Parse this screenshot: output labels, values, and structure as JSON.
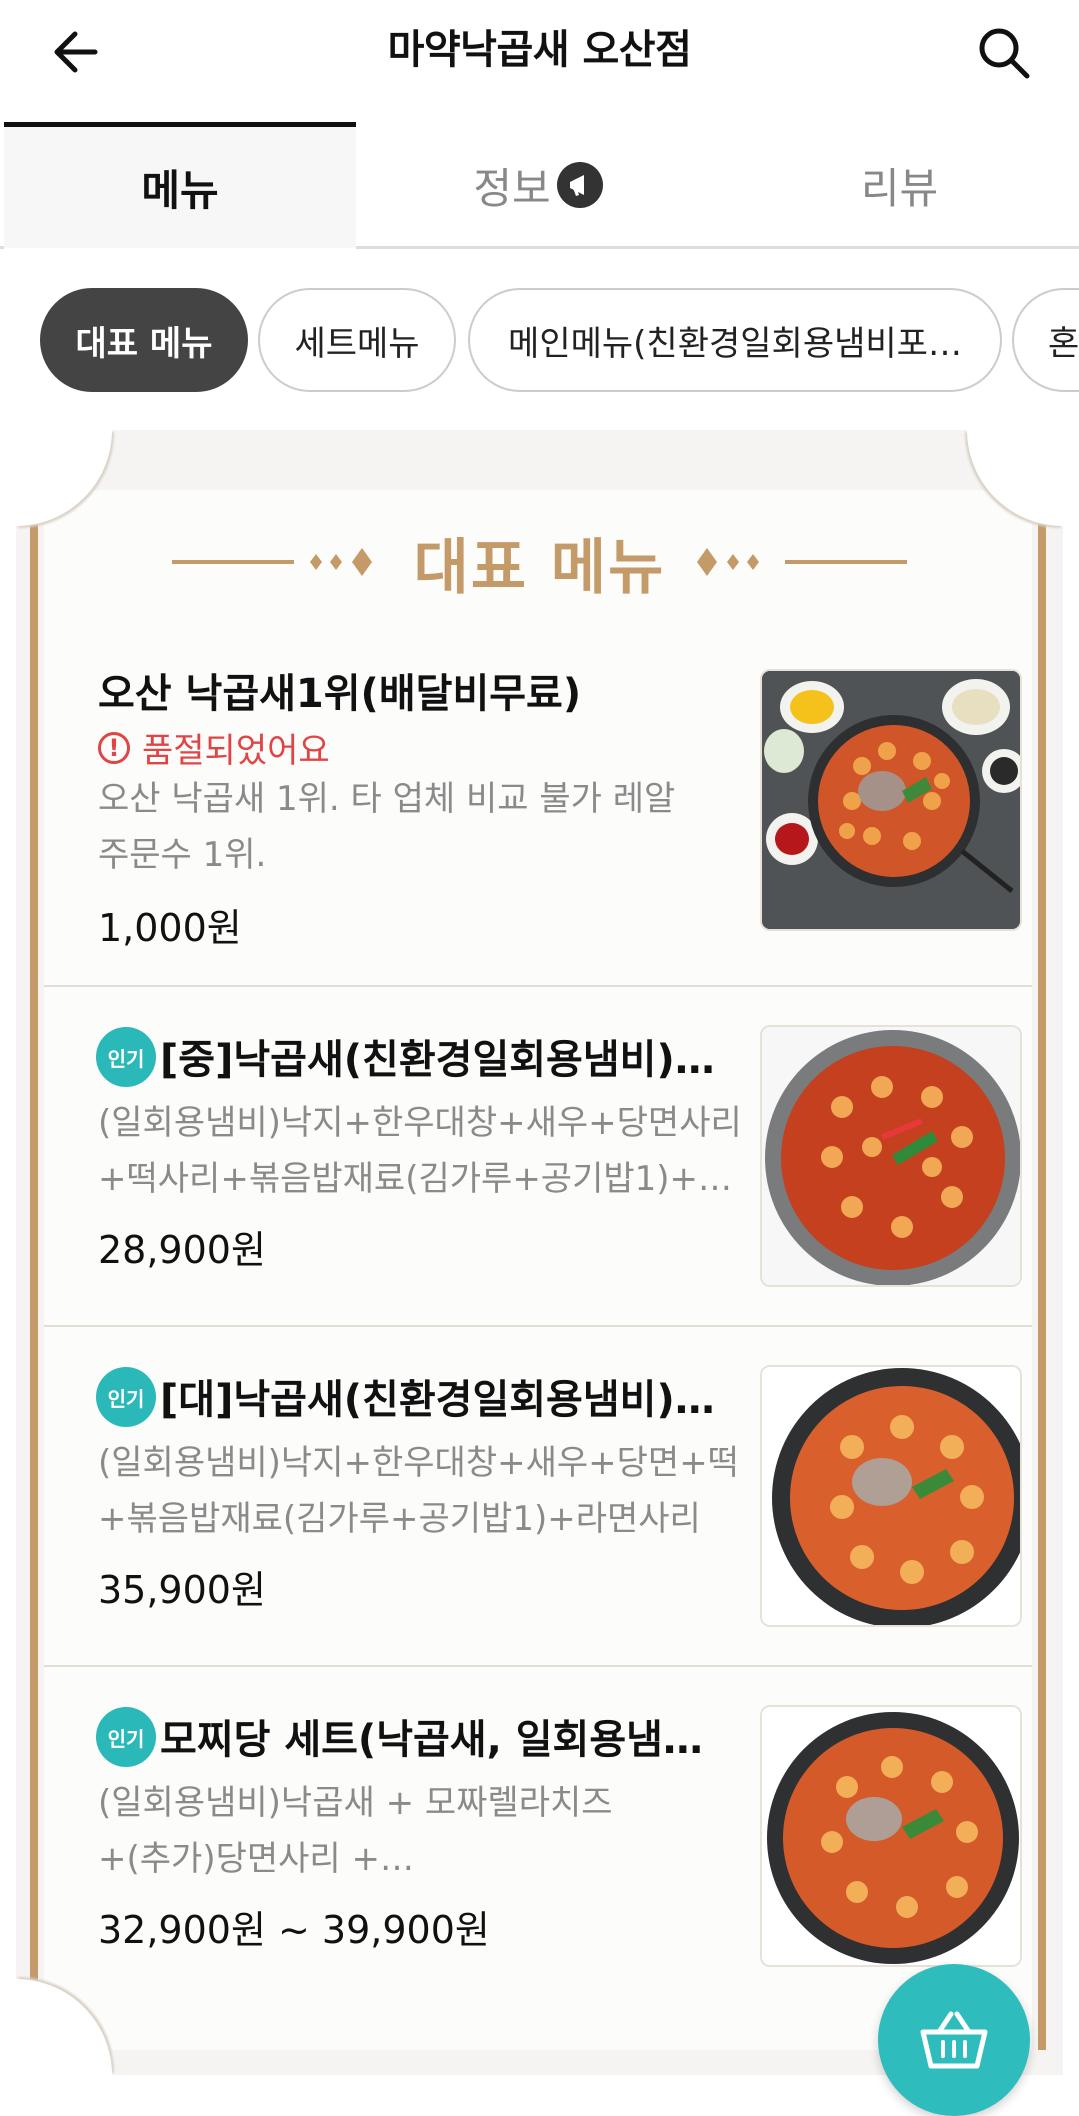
{
  "header": {
    "title": "마약낙곱새 오산점",
    "back_icon": "arrow-left-icon",
    "search_icon": "search-icon"
  },
  "tabs": [
    {
      "label": "메뉴",
      "active": true
    },
    {
      "label": "정보",
      "active": false,
      "badge_icon": "megaphone-icon"
    },
    {
      "label": "리뷰",
      "active": false
    }
  ],
  "chips": [
    {
      "label": "대표 메뉴",
      "active": true
    },
    {
      "label": "세트메뉴",
      "active": false
    },
    {
      "label": "메인메뉴(친환경일회용냄비포…",
      "active": false
    },
    {
      "label": "혼",
      "active": false
    }
  ],
  "section": {
    "title": "대표 메뉴",
    "accent_color": "#c49a69"
  },
  "items": [
    {
      "name": "오산 낙곱새1위(배달비무료)",
      "status": "품절되었어요",
      "desc_line1": "오산 낙곱새 1위. 타 업체 비교 불가 레알",
      "desc_line2": "주문수 1위.",
      "price": "1,000원",
      "badge": ""
    },
    {
      "name": "[중]낙곱새(친환경일회용냄비)…",
      "badge": "인기",
      "desc_line1": "(일회용냄비)낙지+한우대창+새우+당면사리",
      "desc_line2": "+떡사리+볶음밥재료(김가루+공기밥1)+…",
      "price": "28,900원"
    },
    {
      "name": "[대]낙곱새(친환경일회용냄비)…",
      "badge": "인기",
      "desc_line1": "(일회용냄비)낙지+한우대창+새우+당면+떡",
      "desc_line2": "+볶음밥재료(김가루+공기밥1)+라면사리",
      "price": "35,900원"
    },
    {
      "name": "모찌당 세트(낙곱새, 일회용냄…",
      "badge": "인기",
      "desc_line1": "(일회용냄비)낙곱새 + 모짜렐라치즈",
      "desc_line2": "+(추가)당면사리 +…",
      "price": "32,900원 ~ 39,900원"
    }
  ],
  "colors": {
    "badge": "#2bb8b8",
    "soldout": "#e04545",
    "cart_button": "#2fbcbc"
  },
  "cart_icon": "basket-icon"
}
